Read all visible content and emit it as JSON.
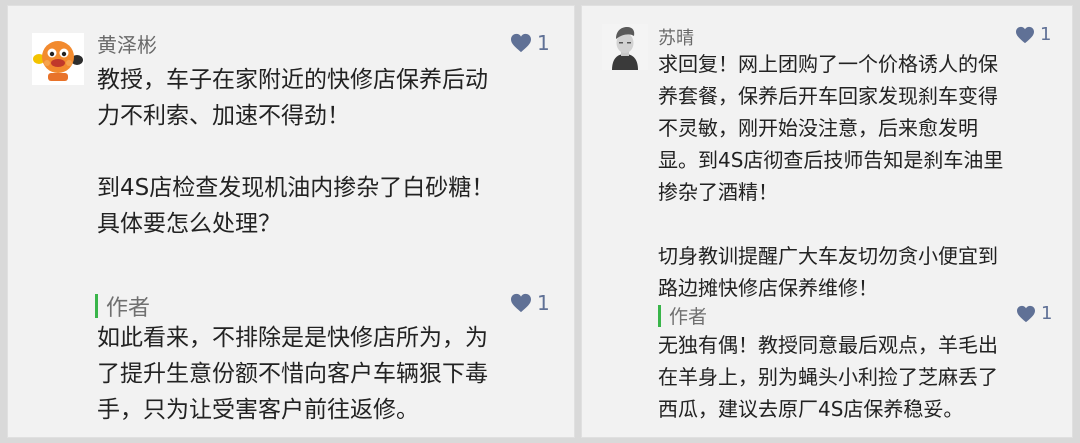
{
  "comments": [
    {
      "user": "黄泽彬",
      "likes": "1",
      "content": "教授，车子在家附近的快修店保养后动\n力不利索、加速不得劲！\n\n到4S店检查发现机油内掺杂了白砂糖！\n具体要怎么处理？",
      "reply": {
        "label": "作者",
        "likes": "1",
        "content": "如此看来，不排除是是快修店所为，为\n了提升生意份额不惜向客户车辆狠下毒\n手，只为让受害客户前往返修。"
      }
    },
    {
      "user": "苏晴",
      "likes": "1",
      "content": "求回复！网上团购了一个价格诱人的保\n养套餐，保养后开车回家发现刹车变得\n不灵敏，刚开始没注意，后来愈发明\n显。到4S店彻查后技师告知是刹车油里\n掺杂了酒精！\n\n切身教训提醒广大车友切勿贪小便宜到\n路边摊快修店保养维修！",
      "reply": {
        "label": "作者",
        "likes": "1",
        "content": "无独有偶！教授同意最后观点，羊毛出\n在羊身上，别为蝇头小利捡了芝麻丢了\n西瓜，建议去原厂4S店保养稳妥。"
      }
    }
  ],
  "colors": {
    "heart": "#607196",
    "reply_bar": "#39b54a",
    "card_bg": "#f2f2f2",
    "page_bg": "#d9d9d9"
  },
  "icons": {
    "like": "heart-icon",
    "avatar_left": "cartoon-avatar",
    "avatar_right": "photo-avatar"
  }
}
